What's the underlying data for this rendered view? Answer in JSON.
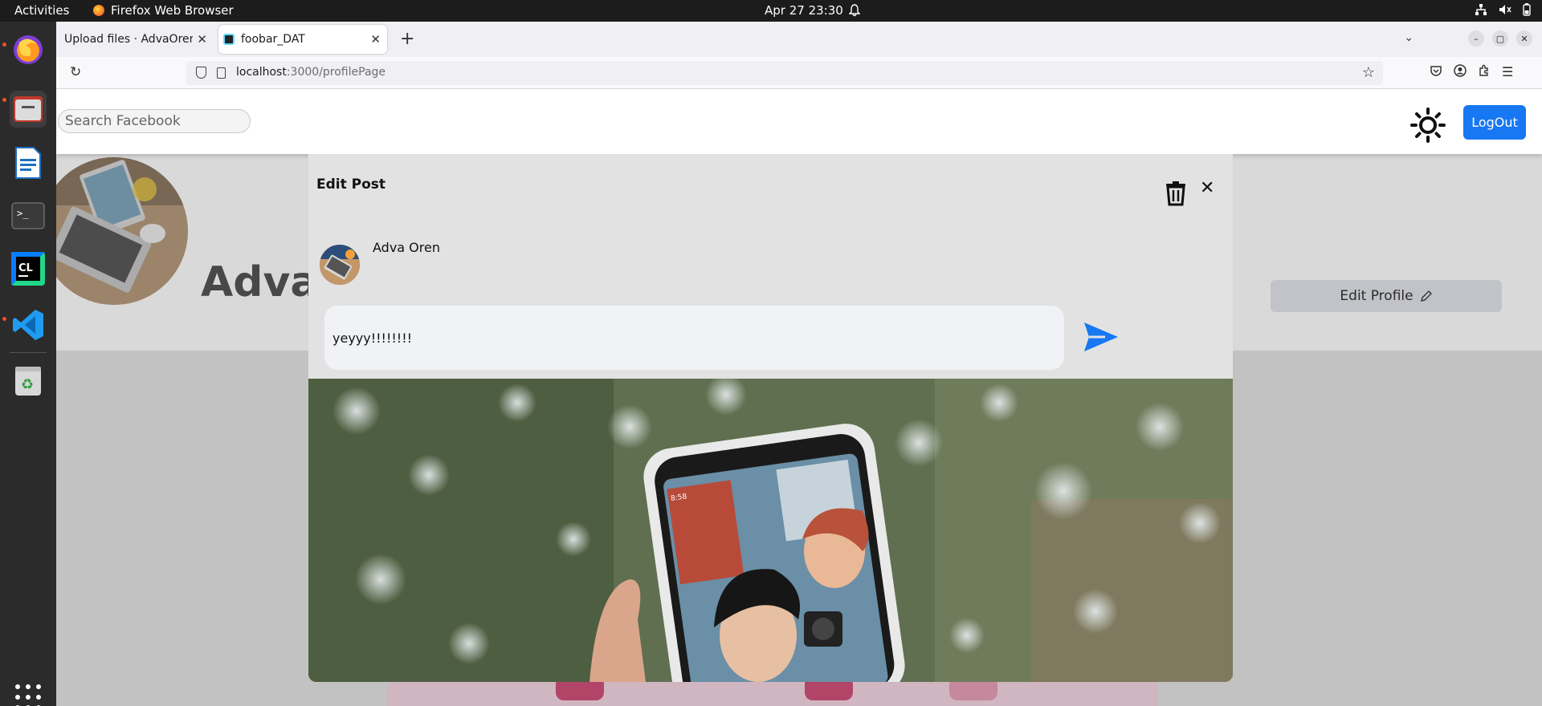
{
  "system": {
    "activities": "Activities",
    "app_name": "Firefox Web Browser",
    "clock": "Apr 27  23:30"
  },
  "browser": {
    "tabs": [
      {
        "label": "Upload files · AdvaOren/f",
        "active": false
      },
      {
        "label": "foobar_DAT",
        "active": true
      }
    ],
    "url_host": "localhost",
    "url_path": ":3000/profilePage"
  },
  "header": {
    "search_placeholder": "Search Facebook",
    "logout_label": "LogOut"
  },
  "profile": {
    "name": "Adva",
    "edit_profile_label": "Edit Profile"
  },
  "modal": {
    "title": "Edit Post",
    "author": "Adva Oren",
    "post_text": "yeyyy!!!!!!!!"
  },
  "colors": {
    "accent": "#1877f2",
    "topbar": "#1c1c1c",
    "dock": "#2b2b2b",
    "modal_bg": "#e2e2e2"
  }
}
